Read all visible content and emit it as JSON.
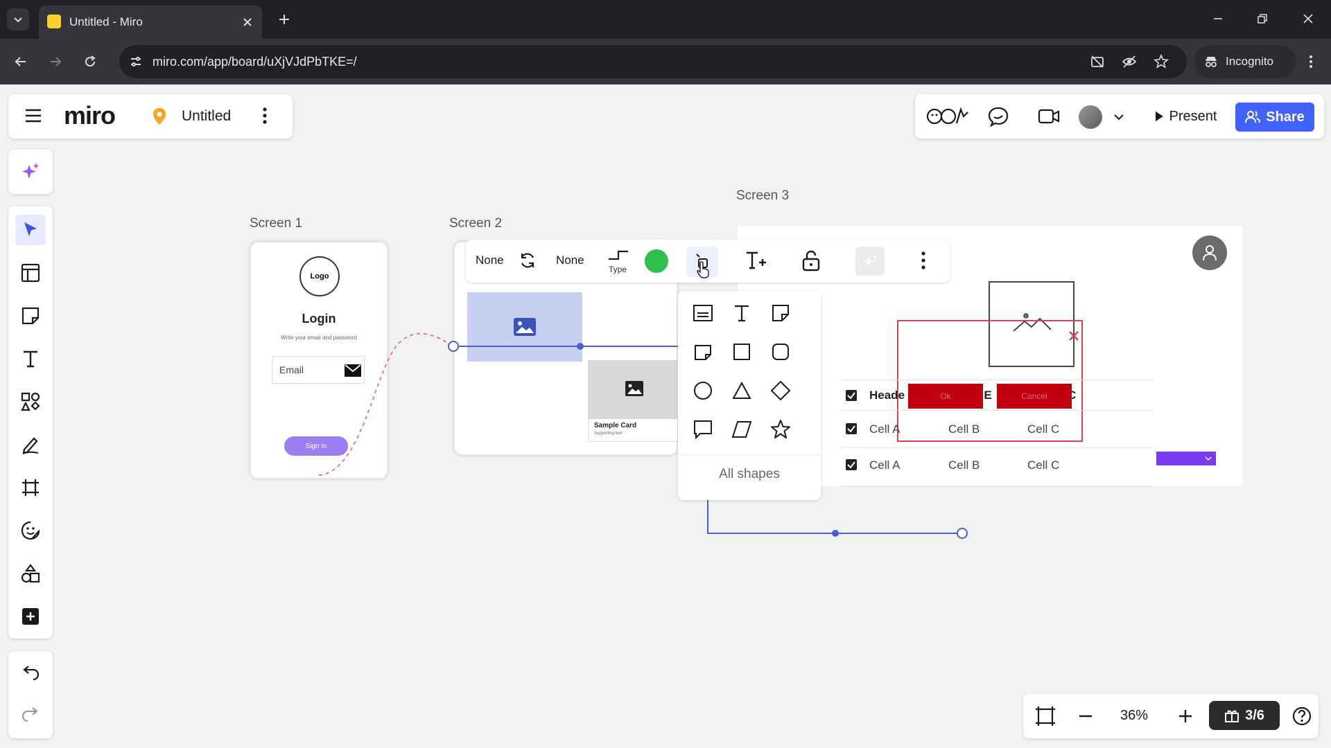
{
  "browser": {
    "tab_title": "Untitled - Miro",
    "url": "miro.com/app/board/uXjVJdPbTKE=/",
    "incognito_label": "Incognito"
  },
  "app": {
    "logo": "miro",
    "board_name": "Untitled",
    "present_label": "Present",
    "share_label": "Share"
  },
  "frames": {
    "screen1": "Screen 1",
    "screen2": "Screen 2",
    "screen3": "Screen 3"
  },
  "screen1": {
    "logo_text": "Logo",
    "title": "Login",
    "subtitle": "Write your email and password",
    "email_placeholder": "Email",
    "signin_label": "Sign in"
  },
  "screen2": {
    "card_title": "Sample Card",
    "card_sub": "Supporting text"
  },
  "screen3": {
    "header_col1": "Heade",
    "header_col2_tail": "r E",
    "header_col3_tail": "C",
    "rows": [
      {
        "a": "Cell A",
        "b": "Cell B",
        "c": "Cell C"
      },
      {
        "a": "Cell A",
        "b": "Cell B",
        "c": "Cell C"
      }
    ],
    "ok_label": "Ok",
    "cancel_label": "Cancel"
  },
  "context_toolbar": {
    "start_cap": "None",
    "end_cap": "None",
    "type_label": "Type",
    "color": "#2fbf4a"
  },
  "shape_menu": {
    "all_shapes_label": "All shapes",
    "shapes": [
      "text-box-shape",
      "text-shape",
      "sticky-shape",
      "folded-note-shape",
      "rectangle-shape",
      "rounded-rectangle-shape",
      "circle-shape",
      "triangle-shape",
      "diamond-shape",
      "speech-bubble-shape",
      "parallelogram-shape",
      "star-shape"
    ]
  },
  "bottom_bar": {
    "zoom": "36%",
    "page_counter": "3/6"
  },
  "colors": {
    "accent": "#4262ff",
    "connector": "#4a5fd6",
    "alert_red": "#c0000f",
    "purple": "#7a3cf0"
  }
}
